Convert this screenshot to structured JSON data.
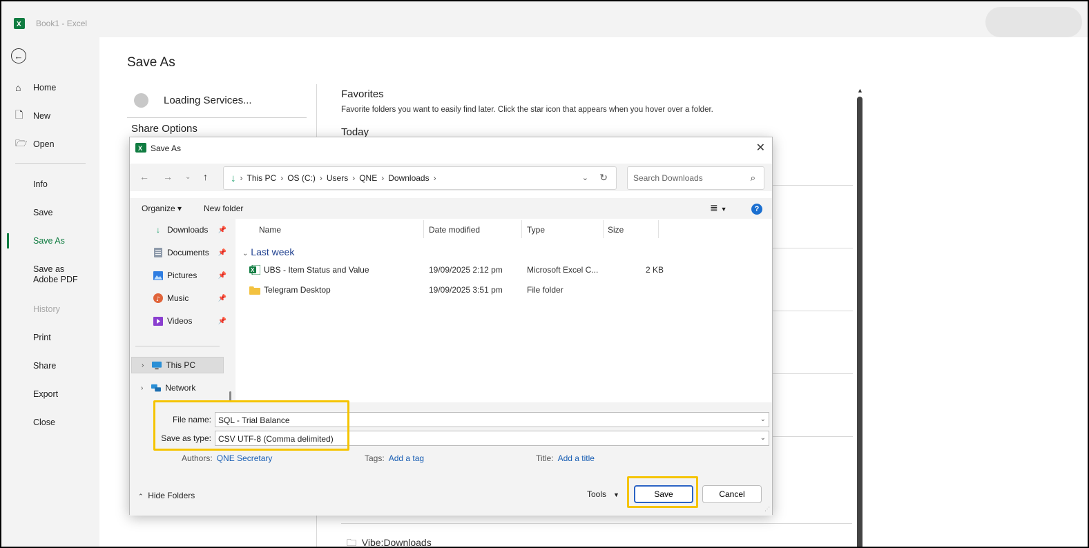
{
  "window": {
    "title": "Book1 - Excel"
  },
  "backstage": {
    "nav": [
      {
        "label": "Home",
        "icon": "home-icon"
      },
      {
        "label": "New",
        "icon": "new-doc-icon"
      },
      {
        "label": "Open",
        "icon": "folder-open-icon"
      },
      {
        "label": "Info"
      },
      {
        "label": "Save"
      },
      {
        "label": "Save As"
      },
      {
        "label": "Save as Adobe PDF"
      },
      {
        "label": "History"
      },
      {
        "label": "Print"
      },
      {
        "label": "Share"
      },
      {
        "label": "Export"
      },
      {
        "label": "Close"
      }
    ],
    "active_item": "Save As",
    "disabled_item": "History",
    "page_title": "Save As",
    "loading_text": "Loading Services...",
    "share_options": "Share Options",
    "favorites_title": "Favorites",
    "favorites_desc": "Favorite folders you want to easily find later. Click the star icon that appears when you hover over a folder.",
    "today": "Today",
    "bottom_folder": "Vibe:Downloads"
  },
  "dialog": {
    "title": "Save As",
    "breadcrumb": [
      "This PC",
      "OS (C:)",
      "Users",
      "QNE",
      "Downloads"
    ],
    "search_placeholder": "Search Downloads",
    "toolbar": {
      "organize": "Organize ▾",
      "new_folder": "New folder"
    },
    "nav_pane": {
      "quick_access": [
        {
          "label": "Downloads",
          "icon": "download-icon"
        },
        {
          "label": "Documents",
          "icon": "documents-icon"
        },
        {
          "label": "Pictures",
          "icon": "pictures-icon"
        },
        {
          "label": "Music",
          "icon": "music-icon"
        },
        {
          "label": "Videos",
          "icon": "videos-icon"
        }
      ],
      "this_pc": "This PC",
      "network": "Network"
    },
    "columns": [
      "Name",
      "Date modified",
      "Type",
      "Size"
    ],
    "group": "Last week",
    "files": [
      {
        "name": "UBS - Item Status and Value",
        "date": "19/09/2025 2:12 pm",
        "type": "Microsoft Excel C...",
        "size": "2 KB",
        "icon": "excel-file-icon"
      },
      {
        "name": "Telegram Desktop",
        "date": "19/09/2025 3:51 pm",
        "type": "File folder",
        "size": "",
        "icon": "folder-icon"
      }
    ],
    "file_name_label": "File name:",
    "file_name": "SQL - Trial Balance",
    "save_type_label": "Save as type:",
    "save_type": "CSV UTF-8 (Comma delimited)",
    "authors_label": "Authors:",
    "authors": "QNE Secretary",
    "tags_label": "Tags:",
    "tags": "Add a tag",
    "title_label": "Title:",
    "title_value": "Add a title",
    "hide_folders": "Hide Folders",
    "tools": "Tools",
    "save": "Save",
    "cancel": "Cancel"
  },
  "colors": {
    "excel_green": "#107c41",
    "highlight": "#f5c400",
    "link_blue": "#1a5fb4"
  }
}
